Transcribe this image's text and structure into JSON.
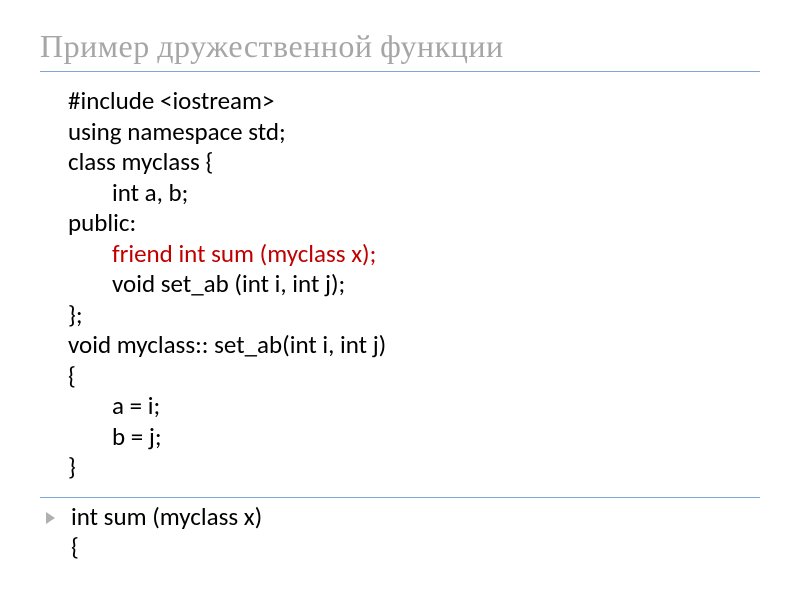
{
  "title": "Пример дружественной функции",
  "code": {
    "l1": "#include <iostream>",
    "l2": "using namespace std;",
    "l3": "class myclass {",
    "l4": "int a, b;",
    "l5": "public:",
    "l6": "friend int sum (myclass x);",
    "l7": "void set_ab (int i, int j);",
    "l8": "};",
    "l9": "void myclass:: set_ab(int i, int j)",
    "l10": "{",
    "l11": "a = i;",
    "l12": "b = j;",
    "l13": "}"
  },
  "bullet": {
    "l1": "int sum (myclass x)",
    "l2": "{"
  }
}
